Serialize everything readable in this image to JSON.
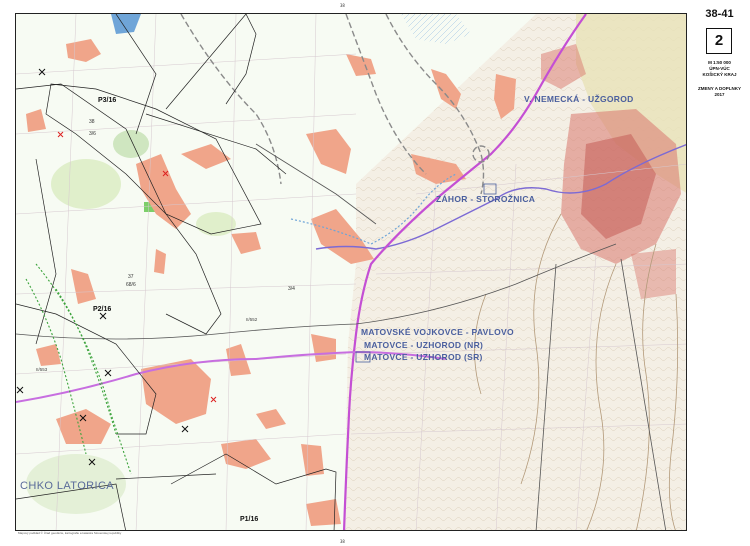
{
  "sheet": {
    "range": "38-41",
    "number": "2",
    "scale": "M 1:50 000",
    "plan_name": "ÚPN-VÚC",
    "region": "KOŠICKÝ KRAJ",
    "change_title": "ZMENY A DOPLNKY",
    "year": "2017"
  },
  "colors": {
    "built_up_existing": "#f0a58a",
    "built_up_city": "#d9776d",
    "state_border": "#c44fd4",
    "wetland": "#6fa5d8",
    "river": "#7c6ad4",
    "terrain_relief": "#b39a7a",
    "forest": "#d6e9b9",
    "protected_green": "#3ca33c",
    "highway_dashed": "#888888",
    "railway": "#555555",
    "planning_line": "#222222",
    "point_red": "#dd2020"
  },
  "places": {
    "uzhorod": "V. NEMECKÁ - UŽGOROD",
    "zahor": "ZÁHOR - STOROŽNICA",
    "crossing_1": "MATOVSKÉ VOJKOVCE - PAVLOVO",
    "crossing_2": "MATOVCE - UZHOROD (NR)",
    "crossing_3": "MATOVCE - UZHOROD (SR)",
    "protected_area": "CHKO LATORICA"
  },
  "planning_areas": [
    "P3/16",
    "P2/16",
    "P1/16"
  ],
  "numbers": [
    "3/6",
    "37",
    "68/6",
    "II/552",
    "II/553",
    "38",
    "3/4"
  ],
  "footnote": "Mapový podklad © Úrad geodézie, kartografie a katastra Slovenskej republiky"
}
